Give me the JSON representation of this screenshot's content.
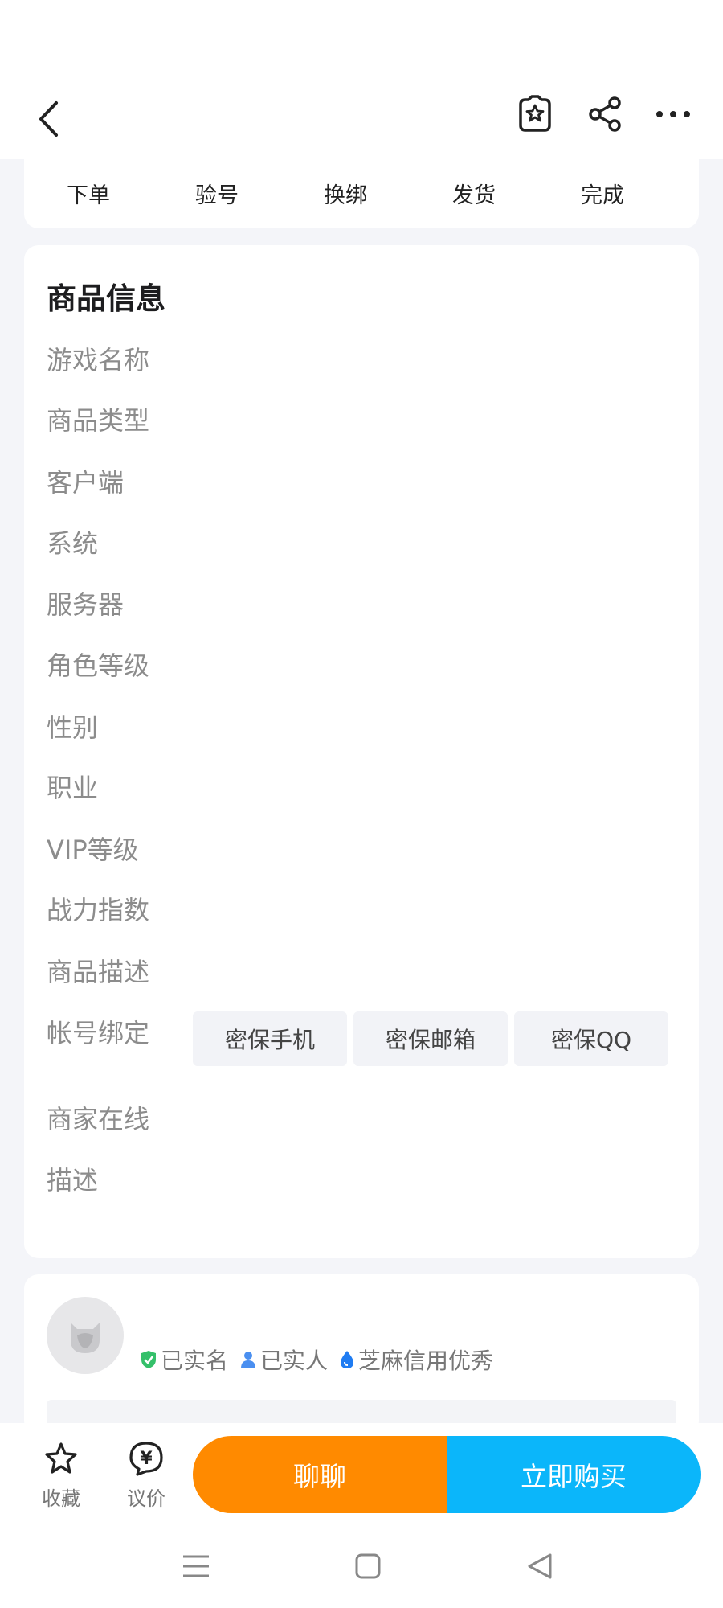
{
  "header": {
    "back_icon": "chevron-left-icon",
    "favorite_icon": "star-badge-icon",
    "share_icon": "share-icon",
    "more_icon": "more-dots-icon"
  },
  "steps": [
    "下单",
    "验号",
    "换绑",
    "发货",
    "完成"
  ],
  "product_info": {
    "title": "商品信息",
    "rows": [
      {
        "label": "游戏名称",
        "value": ""
      },
      {
        "label": "商品类型",
        "value": ""
      },
      {
        "label": "客户端",
        "value": ""
      },
      {
        "label": "系统",
        "value": ""
      },
      {
        "label": "服务器",
        "value": ""
      },
      {
        "label": "角色等级",
        "value": ""
      },
      {
        "label": "性别",
        "value": ""
      },
      {
        "label": "职业",
        "value": ""
      },
      {
        "label": "VIP等级",
        "value": ""
      },
      {
        "label": "战力指数",
        "value": ""
      },
      {
        "label": "商品描述",
        "value": ""
      }
    ],
    "binding_label": "帐号绑定",
    "binding_tags": [
      "密保手机",
      "密保邮箱",
      "密保QQ"
    ],
    "online_label": "商家在线",
    "desc_label": "描述"
  },
  "seller": {
    "badges": [
      {
        "icon": "verified-shield-icon",
        "text": "已实名",
        "color": "#34c06a"
      },
      {
        "icon": "person-icon",
        "text": "已实人",
        "color": "#4a8ff0"
      },
      {
        "icon": "drop-icon",
        "text": "芝麻信用优秀",
        "color": "#1f7cf2"
      }
    ]
  },
  "bottom_bar": {
    "favorite_label": "收藏",
    "bargain_label": "议价",
    "chat_label": "聊聊",
    "buy_label": "立即购买",
    "chat_color": "#ff8a00",
    "buy_color": "#0bb6fa"
  },
  "system_nav": [
    "menu-icon",
    "home-square-icon",
    "back-triangle-icon"
  ]
}
